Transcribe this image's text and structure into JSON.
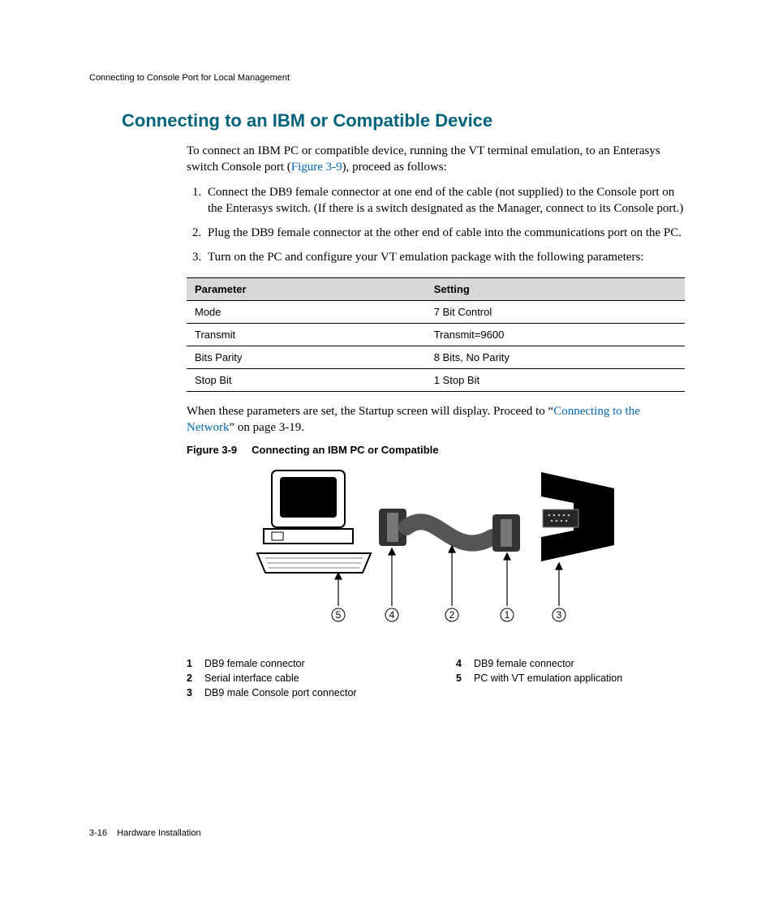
{
  "header": {
    "running": "Connecting to Console Port for Local Management"
  },
  "title": "Connecting to an IBM or Compatible Device",
  "intro": {
    "pre": "To connect an IBM PC or compatible device, running the VT terminal emulation, to an Enterasys switch Console port (",
    "link": "Figure 3-9",
    "post": "), proceed as follows:"
  },
  "steps": [
    "Connect the DB9 female connector at one end of the cable (not supplied) to the Console port on the Enterasys switch. (If there is a switch designated as the Manager, connect to its Console port.)",
    "Plug the DB9 female connector at the other end of cable into the communications port on the PC.",
    "Turn on the PC and configure your VT emulation package with the following parameters:"
  ],
  "table": {
    "headers": [
      "Parameter",
      "Setting"
    ],
    "rows": [
      [
        "Mode",
        "7 Bit Control"
      ],
      [
        "Transmit",
        "Transmit=9600"
      ],
      [
        "Bits Parity",
        "8 Bits, No Parity"
      ],
      [
        "Stop Bit",
        "1 Stop Bit"
      ]
    ]
  },
  "after": {
    "pre": "When these parameters are set, the Startup screen will display. Proceed to “",
    "link": "Connecting to the Network",
    "post": "” on page 3-19."
  },
  "figure": {
    "label": "Figure 3-9",
    "caption": "Connecting an IBM PC or Compatible",
    "callouts": [
      "5",
      "4",
      "2",
      "1",
      "3"
    ]
  },
  "legend": {
    "left": [
      {
        "n": "1",
        "t": "DB9 female connector"
      },
      {
        "n": "2",
        "t": "Serial interface cable"
      },
      {
        "n": "3",
        "t": "DB9 male Console port connector"
      }
    ],
    "right": [
      {
        "n": "4",
        "t": "DB9 female connector"
      },
      {
        "n": "5",
        "t": "PC with VT emulation application"
      }
    ]
  },
  "footer": {
    "page": "3-16",
    "section": "Hardware Installation"
  }
}
